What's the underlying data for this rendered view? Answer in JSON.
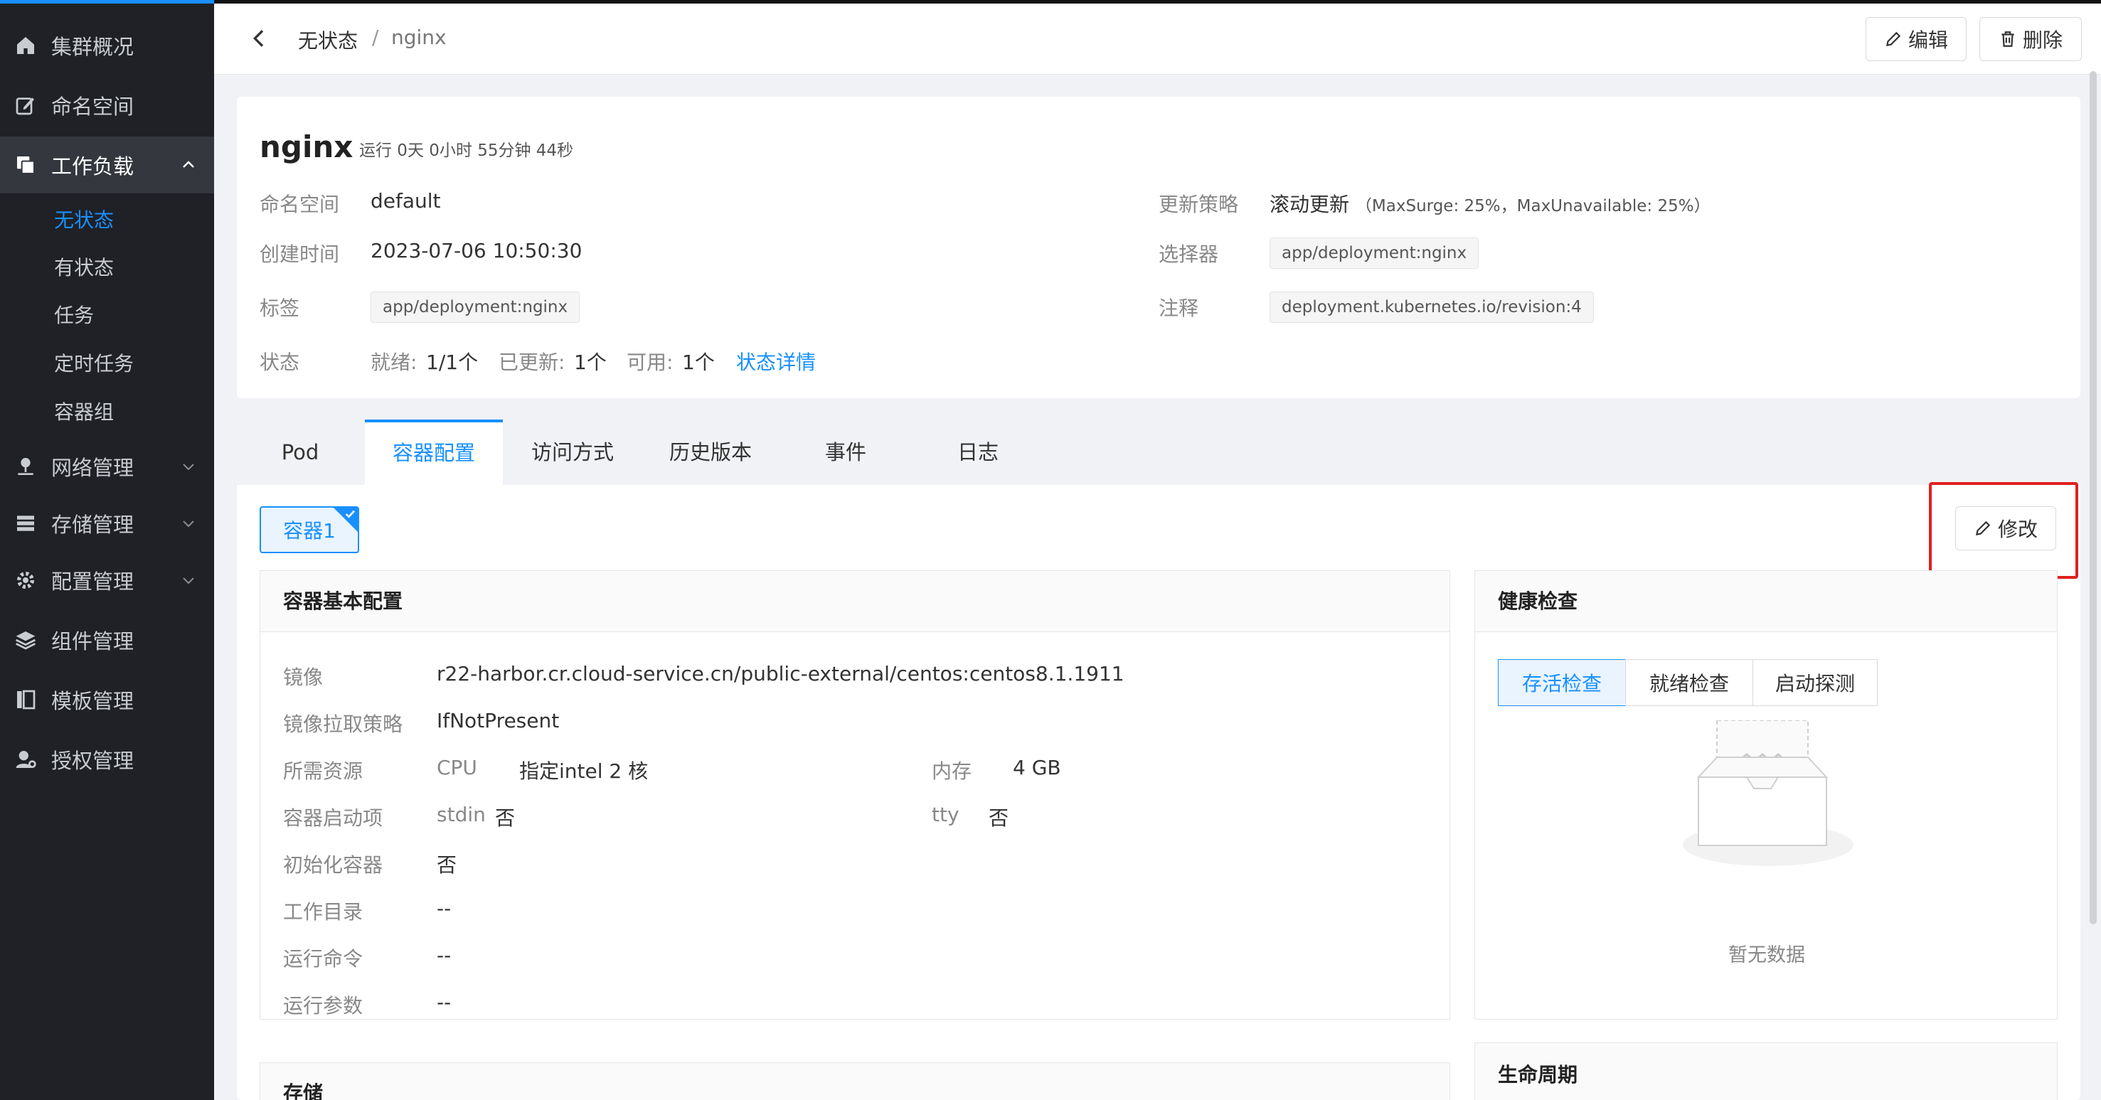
{
  "sidebar": {
    "items": [
      {
        "label": "集群概况",
        "icon": "home-icon"
      },
      {
        "label": "命名空间",
        "icon": "edit-square-icon"
      },
      {
        "label": "工作负载",
        "icon": "copy-icon"
      },
      {
        "label": "网络管理",
        "icon": "network-icon"
      },
      {
        "label": "存储管理",
        "icon": "database-icon"
      },
      {
        "label": "配置管理",
        "icon": "gear-icon"
      },
      {
        "label": "组件管理",
        "icon": "layers-icon"
      },
      {
        "label": "模板管理",
        "icon": "template-icon"
      },
      {
        "label": "授权管理",
        "icon": "user-key-icon"
      }
    ],
    "workload_sub": [
      "无状态",
      "有状态",
      "任务",
      "定时任务",
      "容器组"
    ]
  },
  "header": {
    "breadcrumb_parent": "无状态",
    "breadcrumb_sep": "/",
    "breadcrumb_current": "nginx",
    "edit_label": "编辑",
    "delete_label": "删除"
  },
  "info": {
    "name": "nginx",
    "runtime": "运行 0天 0小时 55分钟 44秒",
    "namespace_label": "命名空间",
    "namespace": "default",
    "created_label": "创建时间",
    "created": "2023-07-06 10:50:30",
    "labels_label": "标签",
    "label_tag": "app/deployment:nginx",
    "status_label": "状态",
    "ready_label": "就绪:",
    "ready": "1/1个",
    "updated_label": "已更新:",
    "updated": "1个",
    "available_label": "可用:",
    "available": "1个",
    "status_detail_link": "状态详情",
    "strategy_label": "更新策略",
    "strategy": "滚动更新",
    "strategy_note": "（MaxSurge: 25%，MaxUnavailable: 25%）",
    "selector_label": "选择器",
    "selector_tag": "app/deployment:nginx",
    "annotation_label": "注释",
    "annotation_tag": "deployment.kubernetes.io/revision:4"
  },
  "tabs": [
    "Pod",
    "容器配置",
    "访问方式",
    "历史版本",
    "事件",
    "日志"
  ],
  "container": {
    "tag": "容器1",
    "modify_label": "修改",
    "basic_title": "容器基本配置",
    "image_label": "镜像",
    "image": "r22-harbor.cr.cloud-service.cn/public-external/centos:centos8.1.1911",
    "pull_label": "镜像拉取策略",
    "pull": "IfNotPresent",
    "resources_label": "所需资源",
    "cpu_label": "CPU",
    "cpu": "指定intel 2 核",
    "mem_label": "内存",
    "mem": "4 GB",
    "start_label": "容器启动项",
    "stdin_label": "stdin",
    "stdin": "否",
    "tty_label": "tty",
    "tty": "否",
    "init_label": "初始化容器",
    "init": "否",
    "workdir_label": "工作目录",
    "workdir": "--",
    "cmd_label": "运行命令",
    "cmd": "--",
    "args_label": "运行参数",
    "args": "--",
    "storage_title": "存储",
    "health_title": "健康检查",
    "health_tabs": [
      "存活检查",
      "就绪检查",
      "启动探测"
    ],
    "empty_text": "暂无数据",
    "lifecycle_title": "生命周期"
  },
  "colors": {
    "accent": "#1890ff",
    "sidebar": "#1f2126",
    "highlight_box": "#e02020"
  }
}
